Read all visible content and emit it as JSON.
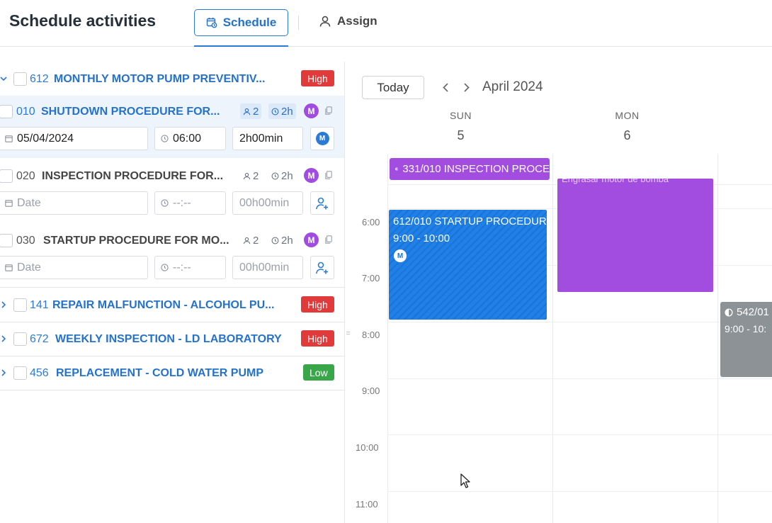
{
  "header": {
    "title": "Schedule activities",
    "tabs": {
      "schedule": "Schedule",
      "assign": "Assign"
    }
  },
  "activities": [
    {
      "num": "612",
      "title": "MONTHLY MOTOR PUMP PREVENTIV...",
      "priority": "High",
      "expanded": true,
      "subs": [
        {
          "num": "010",
          "title": "SHUTDOWN PROCEDURE FOR...",
          "people": "2",
          "duration": "2h",
          "avatar": "M",
          "date": "05/04/2024",
          "time": "06:00",
          "length": "2h00min",
          "assignee": "M"
        },
        {
          "num": "020",
          "title": "INSPECTION PROCEDURE FOR...",
          "people": "2",
          "duration": "2h",
          "avatar": "M",
          "date_placeholder": "Date",
          "time_placeholder": "--:--",
          "length": "00h00min"
        },
        {
          "num": "030",
          "title": "STARTUP PROCEDURE FOR MO...",
          "people": "2",
          "duration": "2h",
          "avatar": "M",
          "date_placeholder": "Date",
          "time_placeholder": "--:--",
          "length": "00h00min"
        }
      ]
    },
    {
      "num": "141",
      "title": "REPAIR MALFUNCTION - ALCOHOL PU...",
      "priority": "High"
    },
    {
      "num": "672",
      "title": "WEEKLY INSPECTION - LD LABORATORY",
      "priority": "High"
    },
    {
      "num": "456",
      "title": "REPLACEMENT - COLD WATER PUMP",
      "priority": "Low"
    }
  ],
  "calendar": {
    "today_label": "Today",
    "month": "April 2024",
    "days": [
      {
        "name": "SUN",
        "num": "5"
      },
      {
        "name": "MON",
        "num": "6"
      }
    ],
    "hours": [
      "6:00",
      "7:00",
      "8:00",
      "9:00",
      "10:00",
      "11:00"
    ],
    "events": {
      "allday": "331/010 INSPECTION PROCE",
      "mon_partial": "Engrasar motor de bomba",
      "sun_title": "612/010 STARTUP PROCEDURE",
      "sun_time": "9:00 - 10:00",
      "sun_avatar": "M",
      "tue_title": "542/01",
      "tue_time": "9:00 - 10:"
    }
  },
  "colors": {
    "accent": "#2b7bd6",
    "high": "#e03a3a",
    "low": "#3aa64a",
    "purple": "#a24ddf",
    "gray_event": "#8d9296"
  }
}
